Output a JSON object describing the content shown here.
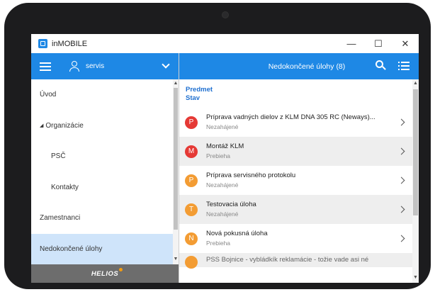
{
  "window": {
    "title": "inMOBILE",
    "controls": [
      "—",
      "☐",
      "✕"
    ]
  },
  "left_header": {
    "user": "servis"
  },
  "right_header": {
    "title": "Nedokončené úlohy (8)"
  },
  "menu": {
    "items": [
      {
        "label": "Úvod",
        "level": 0
      },
      {
        "label": "Organizácie",
        "level": 0,
        "expanded": true
      },
      {
        "label": "PSČ",
        "level": 1
      },
      {
        "label": "Kontakty",
        "level": 1
      },
      {
        "label": "Zamestnanci",
        "level": 0
      },
      {
        "label": "Nedokončené úlohy",
        "level": 0,
        "selected": true
      }
    ],
    "expand_glyph": "◢"
  },
  "brand": "HELIOS",
  "list": {
    "header_line1": "Predmet",
    "header_line2": "Stav",
    "tasks": [
      {
        "initial": "P",
        "color": "#e53935",
        "title": "Príprava vadných dielov z KLM DNA 305 RC (Neways)...",
        "status": "Nezahájené"
      },
      {
        "initial": "M",
        "color": "#e53935",
        "title": "Montáž KLM",
        "status": "Prebieha"
      },
      {
        "initial": "P",
        "color": "#f39c33",
        "title": "Príprava servisného protokolu",
        "status": "Nezahájené"
      },
      {
        "initial": "T",
        "color": "#f39c33",
        "title": "Testovacia úloha",
        "status": "Nezahájené"
      },
      {
        "initial": "N",
        "color": "#f39c33",
        "title": "Nová pokusná úloha",
        "status": "Prebieha"
      }
    ],
    "partial_title": "PSS Bojnice - vybládkík reklamácie - tožie vade asi né"
  },
  "colors": {
    "accent": "#1e88e5",
    "selected": "#cfe4fa",
    "brand_bar": "#6d6d6d"
  }
}
